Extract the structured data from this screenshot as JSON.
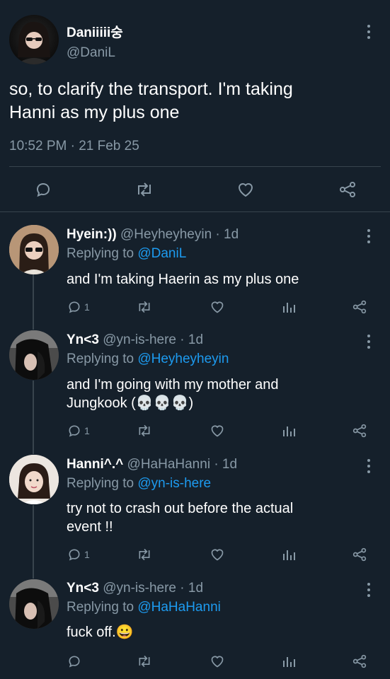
{
  "main_tweet": {
    "name": "Daniiiii숭",
    "handle": "@DaniL",
    "text_line1": "so, to clarify the transport. I'm taking",
    "text_line2": "Hanni as my plus one",
    "timestamp": "10:52 PM · 21 Feb 25"
  },
  "replies": [
    {
      "name": "Hyein:))",
      "meta": "@Heyheyheyin · 1d",
      "replying_label": "Replying to",
      "replying_to": "@DaniL",
      "text_line1": "and I'm taking Haerin as my plus one",
      "text_line2": "",
      "reply_count": "1"
    },
    {
      "name": "Yn<3",
      "meta": "@yn-is-here · 1d",
      "replying_label": "Replying to",
      "replying_to": "@Heyheyheyin",
      "text_line1": "and I'm going with my mother and",
      "text_line2": "Jungkook (💀💀💀)",
      "reply_count": "1"
    },
    {
      "name": "Hanni^.^",
      "meta": "@HaHaHanni · 1d",
      "replying_label": "Replying to",
      "replying_to": "@yn-is-here",
      "text_line1": "try not to crash out before the actual",
      "text_line2": "event !!",
      "reply_count": "1"
    },
    {
      "name": "Yn<3",
      "meta": "@yn-is-here · 1d",
      "replying_label": "Replying to",
      "replying_to": "@HaHaHanni",
      "text_line1": "fuck off.😀",
      "text_line2": "",
      "reply_count": ""
    }
  ],
  "colors": {
    "background": "#15202b",
    "muted": "#8899a6",
    "link": "#1d9bf0",
    "divider": "#38444d"
  },
  "icons": [
    "more-icon",
    "reply-icon",
    "retweet-icon",
    "like-icon",
    "share-icon",
    "views-icon"
  ]
}
